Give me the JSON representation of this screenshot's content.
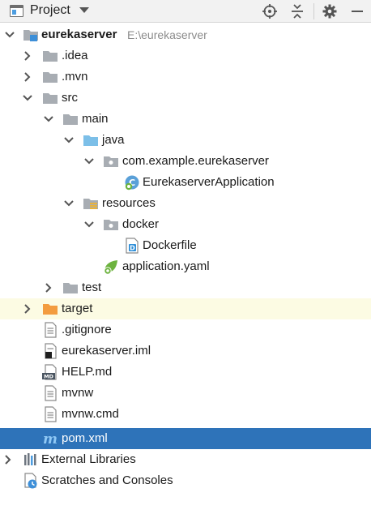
{
  "toolbar": {
    "title": "Project",
    "icons": [
      "project-pane-icon",
      "dropdown-icon",
      "locate-target-icon",
      "collapse-all-icon",
      "settings-gear-icon",
      "hide-minus-icon"
    ]
  },
  "tree": {
    "root": {
      "label": "eurekaserver",
      "path": "E:\\eurekaserver"
    },
    "idea": ".idea",
    "mvn": ".mvn",
    "src": "src",
    "main": "main",
    "java": "java",
    "package": "com.example.eurekaserver",
    "app_class": "EurekaserverApplication",
    "resources": "resources",
    "docker": "docker",
    "dockerfile": "Dockerfile",
    "app_yaml": "application.yaml",
    "test": "test",
    "target": "target",
    "gitignore": ".gitignore",
    "iml": "eurekaserver.iml",
    "help": "HELP.md",
    "mvnw": "mvnw",
    "mvnw_cmd": "mvnw.cmd",
    "pom": "pom.xml",
    "ext_libs": "External Libraries",
    "scratches": "Scratches and Consoles"
  },
  "colors": {
    "selection": "#2e73b9",
    "excluded_highlight": "#fcfbe3",
    "folder_gray": "#a8adb3",
    "folder_blue": "#7cbfe8",
    "folder_orange": "#f39c3f"
  }
}
